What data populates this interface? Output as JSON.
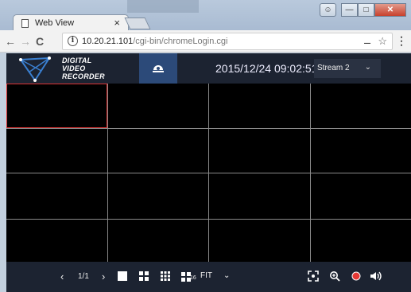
{
  "browser": {
    "tab_title": "Web View",
    "url_host": "10.20.21.101",
    "url_path": "/cgi-bin/chromeLogin.cgi"
  },
  "dvr": {
    "logo_lines": [
      "DIGITAL",
      "VIDEO",
      "RECORDER"
    ],
    "datetime": "2015/12/24 09:02:51",
    "stream_selected": "Stream 2",
    "page_indicator": "1/1",
    "fit_label": "FIT",
    "layout_16_sub": "16",
    "selected_cell_index": 0,
    "grid_rows": 4,
    "grid_cols": 4
  },
  "colors": {
    "header_bg": "#1c2331",
    "active_button": "#2c4a79",
    "selected_cell_border": "#dd3333",
    "record_dot": "#e53935"
  },
  "icons": [
    "page-icon",
    "tab-close-icon",
    "back-arrow-icon",
    "forward-arrow-icon",
    "reload-icon",
    "info-icon",
    "key-icon",
    "star-icon",
    "menu-icon",
    "camera-icon",
    "chevron-down-icon",
    "prev-page-icon",
    "next-page-icon",
    "layout-1-icon",
    "layout-4-icon",
    "layout-9-icon",
    "layout-16-icon",
    "fullscreen-icon",
    "zoom-icon",
    "record-icon",
    "speaker-icon"
  ]
}
